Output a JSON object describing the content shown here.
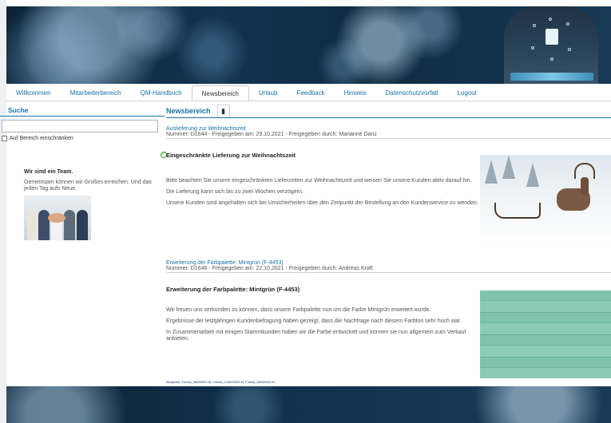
{
  "tabs": [
    {
      "label": "Willkommen"
    },
    {
      "label": "Mitarbeiterbereich"
    },
    {
      "label": "QM-Handbuch"
    },
    {
      "label": "Newsbereich",
      "active": true
    },
    {
      "label": "Urlaub"
    },
    {
      "label": "Feedback"
    },
    {
      "label": "Hinweis"
    },
    {
      "label": "Datenschutzvorfall"
    },
    {
      "label": "Logout"
    }
  ],
  "sidebar": {
    "search_title": "Suche",
    "search_value": "",
    "restrict_label": "Auf Bereich einschränken",
    "team_title": "Wir sind ein Team.",
    "team_text": "Gemeinsam können wir Großes erreichen. Und das jeden Tag aufs Neue."
  },
  "news": {
    "title": "Newsbereich",
    "bookmark_icon": "bookmark-icon",
    "articles": [
      {
        "link": "Auslieferung zur Weihnachtszeit",
        "meta": "Nummer: D1644 - Freigegeben am: 29.10.2021 - Freigegeben durch: Marianne Danz",
        "heading": "Eingeschränkte Lieferung zur Weihnachtszeit",
        "paragraphs": [
          "Bitte beachten Sie unsere eingeschränkten Lieferzeiten zur Weihnachtszeit und weisen Sie unsere Kunden aktiv darauf hin.",
          "Die Lieferung kann sich bis zu zwei Wochen verzögern.",
          "Unsere Kunden sind angehalten sich bei Unsicherheiten über den Zeitpunkt der Bestellung an den Kundenservice zu wenden."
        ]
      },
      {
        "link": "Erweiterung der Farbpalette: Mintgrün (F-4453)",
        "meta": "Nummer: D1646 - Freigegeben am: 22.10.2021 - Freigegeben durch: Andreas Kraft",
        "heading": "Erweiterung der Farbpalette: Mintgrün (F-4453)",
        "paragraphs": [
          "Wir freuen uns verkünden zu können, dass unsere Farbpalette nun um die Farbe Mintgrün erweitert wurde.",
          "Ergebnisse der letztjährigen Kundenbefragung haben gezeigt, dass die Nachfrage nach diesem Farbton sehr hoch war.",
          "In Zusammenarbeit mit einigen Stammkunden haben wir die Farbe entwickelt und können sie nun allgemein zum Verkauf anbieten."
        ]
      }
    ],
    "credits": "Bildquelle: Fotolia_98855500.M, Fotolia_125200303.M, Fotolia_98530031.M"
  },
  "colors": {
    "link": "#1a73a8",
    "banner": "#123450",
    "ok": "#3a9e3a"
  }
}
